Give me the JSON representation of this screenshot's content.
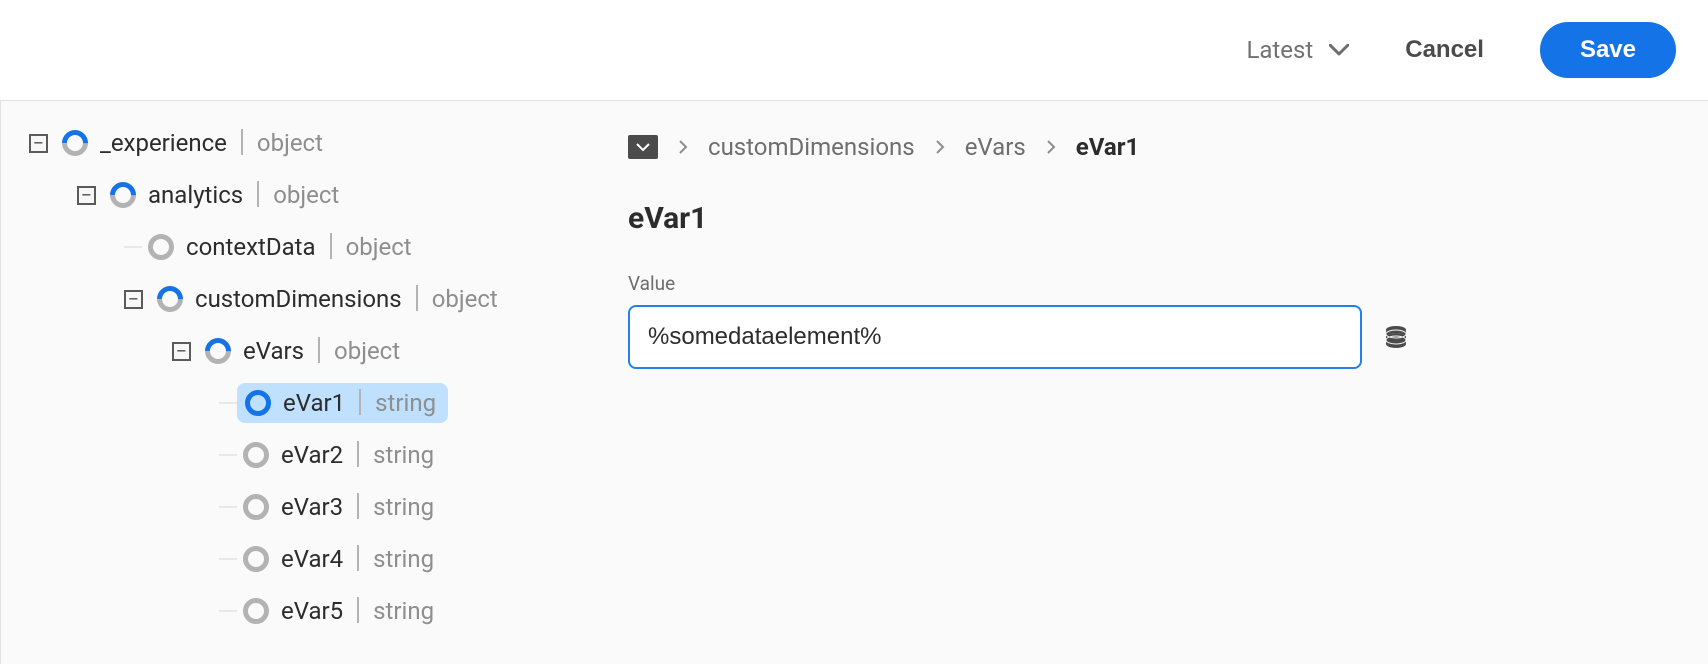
{
  "toolbar": {
    "version_label": "Latest",
    "cancel_label": "Cancel",
    "save_label": "Save"
  },
  "tree": {
    "experience": {
      "label": "_experience",
      "type": "object"
    },
    "analytics": {
      "label": "analytics",
      "type": "object"
    },
    "contextData": {
      "label": "contextData",
      "type": "object"
    },
    "customDimensions": {
      "label": "customDimensions",
      "type": "object"
    },
    "eVars": {
      "label": "eVars",
      "type": "object"
    },
    "evar_items": [
      {
        "label": "eVar1",
        "type": "string"
      },
      {
        "label": "eVar2",
        "type": "string"
      },
      {
        "label": "eVar3",
        "type": "string"
      },
      {
        "label": "eVar4",
        "type": "string"
      },
      {
        "label": "eVar5",
        "type": "string"
      }
    ]
  },
  "breadcrumb": {
    "items": [
      "customDimensions",
      "eVars"
    ],
    "current": "eVar1"
  },
  "detail": {
    "title": "eVar1",
    "value_label": "Value",
    "value": "%somedataelement%"
  }
}
